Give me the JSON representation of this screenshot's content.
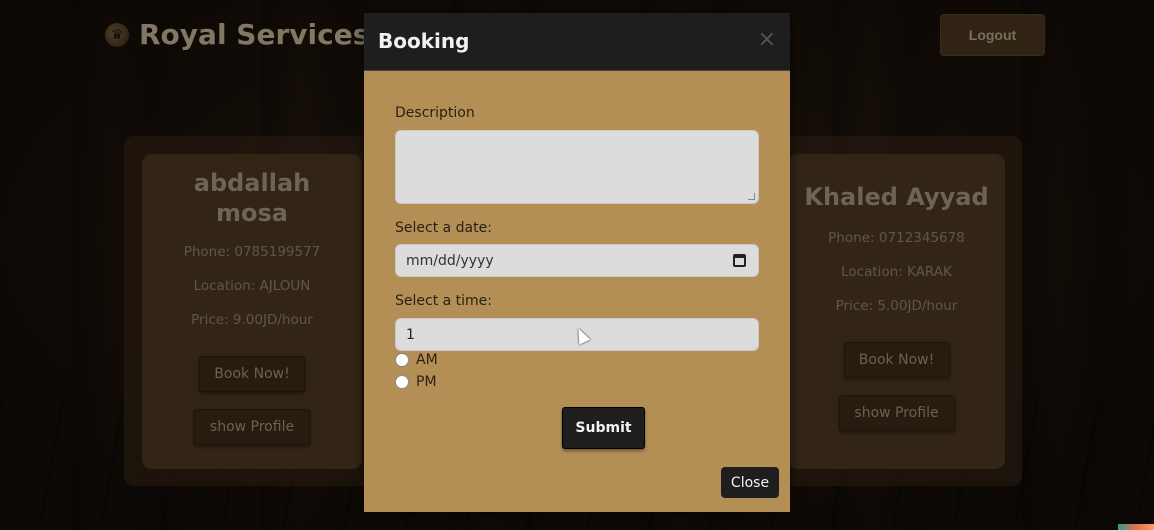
{
  "header": {
    "brand": "Royal Services",
    "nav_partial": "e",
    "logout_label": "Logout"
  },
  "cards": [
    {
      "name": "abdallah mosa",
      "phone": "Phone: 0785199577",
      "location": "Location: AJLOUN",
      "price": "Price: 9.00JD/hour",
      "book_label": "Book Now!",
      "profile_label": "show Profile"
    },
    {
      "name": "Khaled Ayyad",
      "phone": "Phone: 0712345678",
      "location": "Location: KARAK",
      "price": "Price: 5.00JD/hour",
      "book_label": "Book Now!",
      "profile_label": "show Profile"
    }
  ],
  "modal": {
    "title": "Booking",
    "close_x": "×",
    "description_label": "Description",
    "description_value": "",
    "date_label": "Select a date:",
    "date_placeholder": "mm/dd/yyyy",
    "time_label": "Select a time:",
    "time_value": "1",
    "am_label": "AM",
    "pm_label": "PM",
    "submit_label": "Submit",
    "close_label": "Close"
  },
  "colors": {
    "modal_bg": "#b48f55",
    "modal_header": "#1e1e1e",
    "card_bg": "#4f3a22"
  }
}
